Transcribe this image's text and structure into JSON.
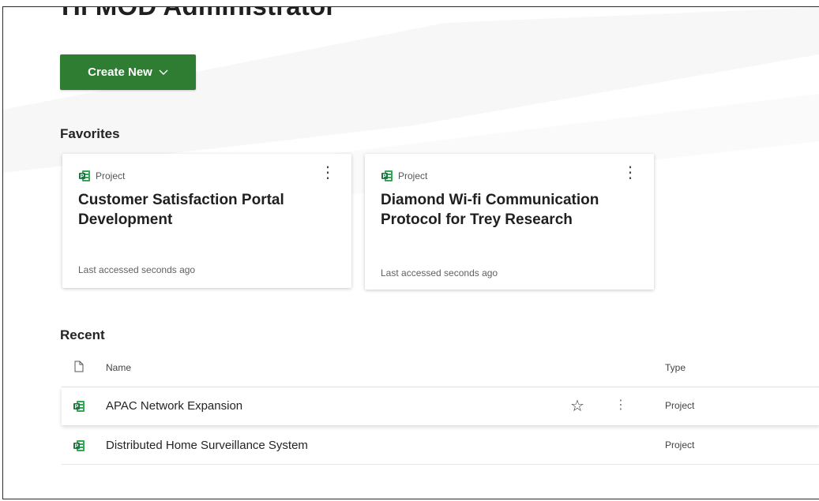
{
  "header": {
    "greeting": "Hi MOD Administrator"
  },
  "toolbar": {
    "create_label": "Create New",
    "create_icon": "chevron-down-icon"
  },
  "favorites": {
    "title": "Favorites",
    "cards": [
      {
        "type": "Project",
        "name": "Customer Satisfaction Portal Development",
        "meta": "Last accessed seconds ago"
      },
      {
        "type": "Project",
        "name": "Diamond Wi-fi Communication Protocol for Trey Research",
        "meta": "Last accessed seconds ago"
      }
    ]
  },
  "recent": {
    "title": "Recent",
    "columns": {
      "name": "Name",
      "type": "Type"
    },
    "rows": [
      {
        "name": "APAC Network Expansion",
        "type": "Project"
      },
      {
        "name": "Distributed Home Surveillance System",
        "type": "Project"
      }
    ]
  },
  "colors": {
    "accent": "#2e7d32",
    "project_icon": "#217346"
  }
}
